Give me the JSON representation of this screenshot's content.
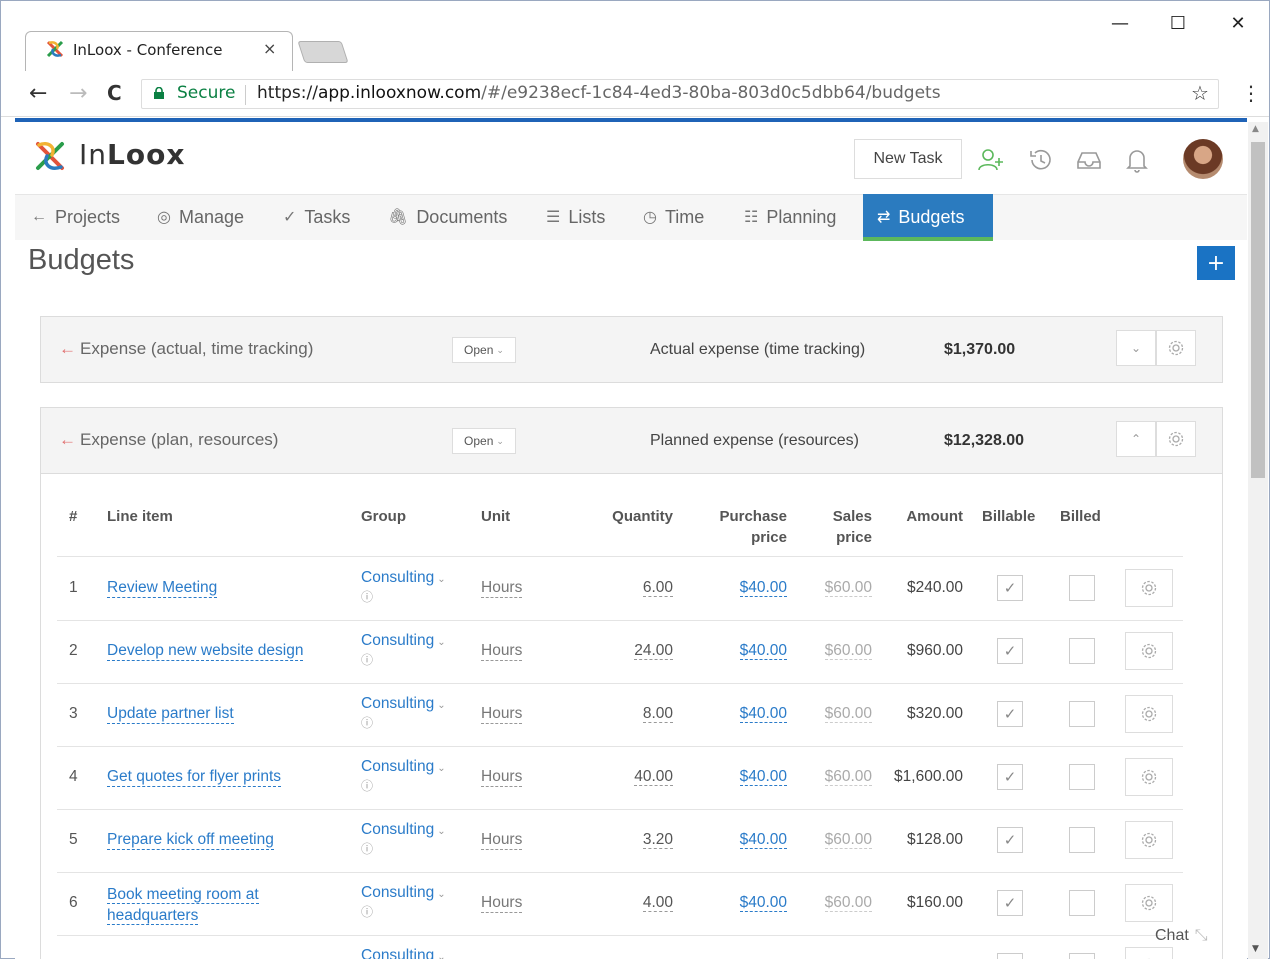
{
  "browser": {
    "tab_title": "InLoox - Conference",
    "tab_close": "×",
    "secure_label": "Secure",
    "url_scheme": "https://",
    "url_host": "app.inlooxnow.com",
    "url_path": "/#/e9238ecf-1c84-4ed3-80ba-803d0c5dbb64/budgets",
    "minimize": "—",
    "maximize": "☐",
    "close": "✕",
    "back": "←",
    "forward": "→",
    "reload": "C",
    "star": "☆",
    "menu": "⋮"
  },
  "app": {
    "brand_in": "In",
    "brand_loox": "Loox",
    "new_task": "New Task",
    "page_title": "Budgets",
    "add_button": "+",
    "chat": "Chat",
    "accent_color": "#2b7bbf",
    "active_underline": "#5cb85c"
  },
  "nav": [
    {
      "icon": "←",
      "label": "Projects"
    },
    {
      "icon": "◎",
      "label": "Manage"
    },
    {
      "icon": "✓",
      "label": "Tasks"
    },
    {
      "icon": "🖇",
      "label": "Documents"
    },
    {
      "icon": "☰",
      "label": "Lists"
    },
    {
      "icon": "◷",
      "label": "Time"
    },
    {
      "icon": "☷",
      "label": "Planning"
    },
    {
      "icon": "⇄",
      "label": "Budgets"
    }
  ],
  "budgets": [
    {
      "title": "Expense (actual, time tracking)",
      "status": "Open",
      "label": "Actual expense (time tracking)",
      "amount": "$1,370.00",
      "expanded": false
    },
    {
      "title": "Expense (plan, resources)",
      "status": "Open",
      "label": "Planned expense (resources)",
      "amount": "$12,328.00",
      "expanded": true
    }
  ],
  "table": {
    "headers": {
      "num": "#",
      "line_item": "Line item",
      "group": "Group",
      "unit": "Unit",
      "quantity": "Quantity",
      "purchase_1": "Purchase",
      "purchase_2": "price",
      "sales_1": "Sales",
      "sales_2": "price",
      "amount": "Amount",
      "billable": "Billable",
      "billed": "Billed"
    },
    "rows": [
      {
        "num": "1",
        "item": "Review Meeting",
        "item2": "",
        "group": "Consulting",
        "unit": "Hours",
        "qty": "6.00",
        "pp": "$40.00",
        "sp": "$60.00",
        "amount": "$240.00",
        "billable": true,
        "billed": false
      },
      {
        "num": "2",
        "item": "Develop new website design",
        "item2": "",
        "group": "Consulting",
        "unit": "Hours",
        "qty": "24.00",
        "pp": "$40.00",
        "sp": "$60.00",
        "amount": "$960.00",
        "billable": true,
        "billed": false
      },
      {
        "num": "3",
        "item": "Update partner list",
        "item2": "",
        "group": "Consulting",
        "unit": "Hours",
        "qty": "8.00",
        "pp": "$40.00",
        "sp": "$60.00",
        "amount": "$320.00",
        "billable": true,
        "billed": false
      },
      {
        "num": "4",
        "item": "Get quotes for flyer prints",
        "item2": "",
        "group": "Consulting",
        "unit": "Hours",
        "qty": "40.00",
        "pp": "$40.00",
        "sp": "$60.00",
        "amount": "$1,600.00",
        "billable": true,
        "billed": false
      },
      {
        "num": "5",
        "item": "Prepare kick off meeting",
        "item2": "",
        "group": "Consulting",
        "unit": "Hours",
        "qty": "3.20",
        "pp": "$40.00",
        "sp": "$60.00",
        "amount": "$128.00",
        "billable": true,
        "billed": false
      },
      {
        "num": "6",
        "item": "Book meeting room at",
        "item2": "headquarters",
        "group": "Consulting",
        "unit": "Hours",
        "qty": "4.00",
        "pp": "$40.00",
        "sp": "$60.00",
        "amount": "$160.00",
        "billable": true,
        "billed": false
      },
      {
        "num": "",
        "item": "",
        "item2": "",
        "group": "Consulting",
        "unit": "",
        "qty": "",
        "pp": "",
        "sp": "",
        "amount": "",
        "billable": false,
        "billed": false
      }
    ]
  }
}
